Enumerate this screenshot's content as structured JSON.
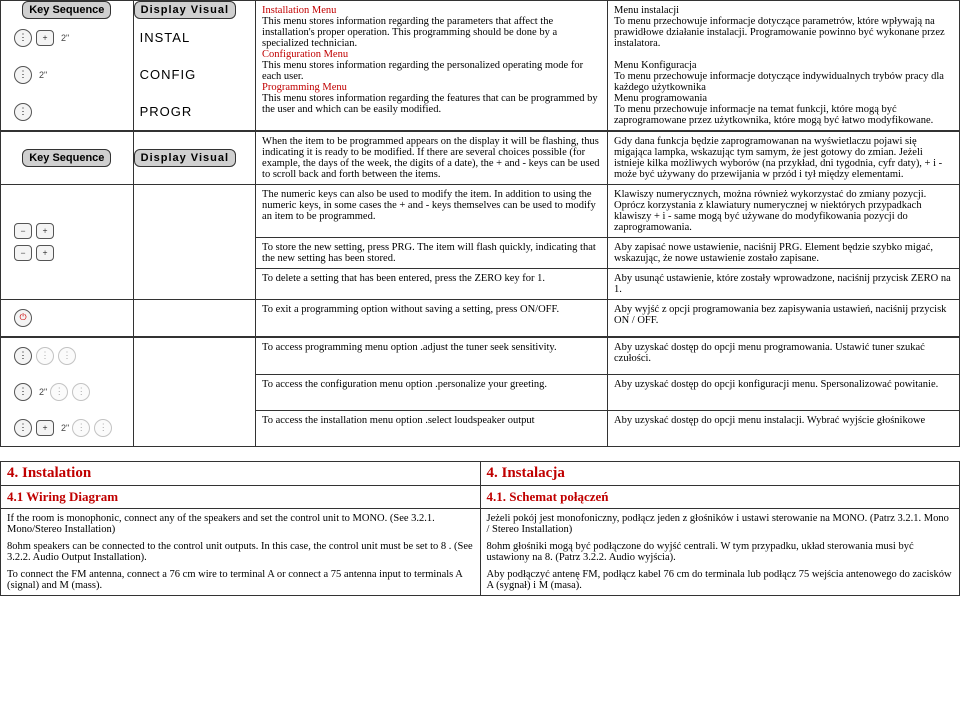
{
  "hdr": {
    "key": "Key Sequence",
    "disp": "Display Visual"
  },
  "disp": {
    "instal": "INSTAL",
    "config": "CONFIG",
    "progr": "PROGR"
  },
  "dur": {
    "two": "2\""
  },
  "menus": {
    "en": {
      "install_t": "Installation Menu",
      "install_b": "This menu stores information regarding the parameters that affect the installation's proper operation. This programming should be done by a specialized technician.",
      "config_t": "Configuration Menu",
      "config_b": "This menu stores information regarding the personalized operating mode for each user.",
      "prog_t": "Programming Menu",
      "prog_b": "This menu stores information regarding the features that can be programmed by the user and which can be easily modified."
    },
    "pl": {
      "install_t": "Menu instalacji",
      "install_b": "To menu przechowuje informacje dotyczące parametrów, które wpływają na prawidłowe działanie instalacji. Programowanie powinno być wykonane przez instalatora.",
      "config_t": "Menu Konfiguracja",
      "config_b": "To menu przechowuje informacje dotyczące indywidualnych trybów pracy dla każdego użytkownika",
      "prog_t": "Menu programowania",
      "prog_b": "To menu przechowuje informacje na temat funkcji, które mogą być zaprogramowane przez użytkownika, które mogą być łatwo modyfikowane."
    }
  },
  "prog": {
    "en": {
      "p1": "When the item to be programmed appears on the display it will be flashing, thus indicating it is ready to be modified. If there are several choices possible (for example, the days of the week, the digits of a date), the + and - keys can be used to scroll back and forth between the items.",
      "p2": "The numeric keys can also be used to modify the item. In addition to using the numeric keys, in some cases the + and - keys themselves can be used to modify an item to be programmed.",
      "p3": "To store the new setting, press PRG. The item will flash quickly, indicating that the new setting has been stored.",
      "p4": "To delete a setting that has been entered, press the ZERO key for 1.",
      "p5": "To exit a programming option without saving a setting, press ON/OFF."
    },
    "pl": {
      "p1": "Gdy dana funkcja będzie zaprogramowanan na wyświetlaczu pojawi się migająca lampka, wskazując tym samym, że jest gotowy do zmian. Jeżeli istnieje kilka możliwych wyborów (na przykład, dni tygodnia, cyfr daty), + i - może być używany do przewijania w przód i tył między elementami.",
      "p2": "Klawiszy numerycznych, można również wykorzystać do zmiany pozycji. Oprócz korzystania z klawiatury numerycznej w niektórych przypadkach klawiszy + i - same mogą być używane do modyfikowania pozycji do zaprogramowania.",
      "p3": "Aby zapisać nowe ustawienie, naciśnij PRG. Element będzie szybko migać, wskazując, że nowe ustawienie zostało zapisane.",
      "p4": "Aby usunąć ustawienie, które zostały wprowadzone, naciśnij przycisk ZERO na 1.",
      "p5": "Aby wyjść z opcji programowania bez zapisywania ustawień, naciśnij przycisk ON / OFF."
    }
  },
  "access": {
    "en": {
      "prog": "To access programming menu option .adjust the tuner seek sensitivity.",
      "config": "To access the configuration menu option .personalize your greeting.",
      "install": "To access the installation menu option .select loudspeaker output"
    },
    "pl": {
      "prog": "Aby uzyskać dostęp do opcji menu programowania. Ustawić tuner szukać czułości.",
      "config": "Aby uzyskać dostęp do opcji konfiguracji menu. Spersonalizować powitanie.",
      "install": "Aby uzyskać dostęp do opcji menu instalacji. Wybrać wyjście głośnikowe"
    }
  },
  "section": {
    "en": {
      "s4": "4. Instalation",
      "s41": "4.1 Wiring Diagram",
      "b1": "If the room is monophonic, connect any of the speakers and set the control unit to MONO. (See 3.2.1. Mono/Stereo Installation)",
      "b2": "8ohm speakers can be connected to the control unit outputs. In this case, the control unit must be set to 8 . (See 3.2.2. Audio Output Installation).",
      "b3": "To connect the FM antenna, connect a 76 cm wire to terminal A or connect a 75 antenna input to terminals A (signal) and M (mass)."
    },
    "pl": {
      "s4": "4. Instalacja",
      "s41": "4.1. Schemat połączeń",
      "b1": "Jeżeli pokój jest monofoniczny, podłącz jeden z głośników i ustawi sterowanie na MONO. (Patrz 3.2.1. Mono / Stereo Installation)",
      "b2": "8ohm głośniki mogą być podłączone do wyjść centrali. W tym przypadku, układ sterowania musi być ustawiony na 8. (Patrz 3.2.2. Audio wyjścia).",
      "b3": "Aby podłączyć antenę FM, podłącz kabel 76 cm do terminala lub podłącz 75 wejścia antenowego do zacisków A (sygnał) i M (masa)."
    }
  }
}
